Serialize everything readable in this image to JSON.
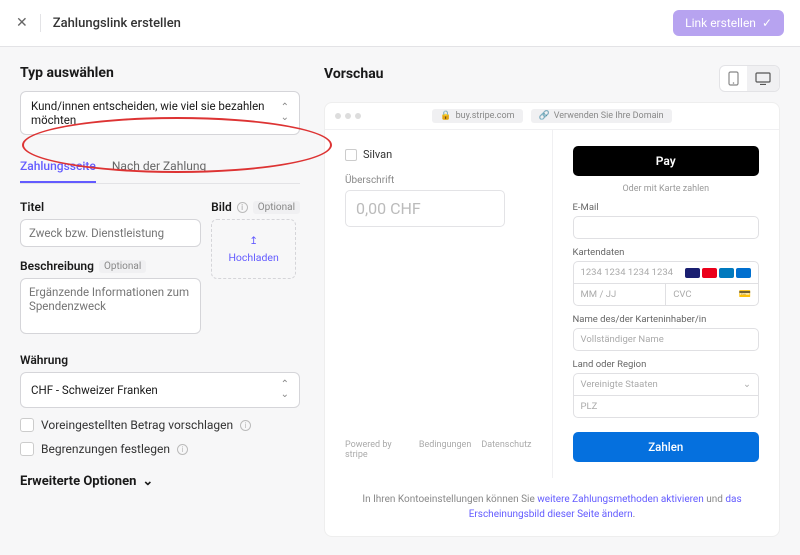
{
  "header": {
    "title": "Zahlungslink erstellen",
    "cta": "Link erstellen"
  },
  "left": {
    "type_heading": "Typ auswählen",
    "type_value": "Kund/innen entscheiden, wie viel sie bezahlen möchten",
    "tabs": {
      "page": "Zahlungsseite",
      "after": "Nach der Zahlung"
    },
    "title_label": "Titel",
    "title_placeholder": "Zweck bzw. Dienstleistung",
    "image_label": "Bild",
    "optional_tag": "Optional",
    "upload_label": "Hochladen",
    "desc_label": "Beschreibung",
    "desc_placeholder": "Ergänzende Informationen zum Spendenzweck",
    "currency_label": "Währung",
    "currency_value": "CHF - Schweizer Franken",
    "suggest_amount": "Voreingestellten Betrag vorschlagen",
    "set_limits": "Begrenzungen festlegen",
    "advanced": "Erweiterte Optionen"
  },
  "preview": {
    "heading": "Vorschau",
    "url": "buy.stripe.com",
    "use_domain": "Verwenden Sie Ihre Domain",
    "brand": "Silvan",
    "overline": "Überschrift",
    "amount_placeholder": "0,00 CHF",
    "powered": "Powered by stripe",
    "terms": "Bedingungen",
    "privacy": "Datenschutz",
    "apple_pay": "Pay",
    "or_card": "Oder mit Karte zahlen",
    "email": "E-Mail",
    "card_data": "Kartendaten",
    "card_num": "1234 1234 1234 1234",
    "expiry": "MM / JJ",
    "cvc": "CVC",
    "holder": "Name des/der Karteninhaber/in",
    "holder_ph": "Vollständiger Name",
    "country": "Land oder Region",
    "country_val": "Vereinigte Staaten",
    "zip": "PLZ",
    "pay_btn": "Zahlen"
  },
  "footer": {
    "prefix": "In Ihren Kontoeinstellungen können Sie ",
    "link1": "weitere Zahlungsmethoden aktivieren",
    "mid": " und ",
    "link2": "das Erscheinungsbild dieser Seite ändern",
    "suffix": "."
  }
}
